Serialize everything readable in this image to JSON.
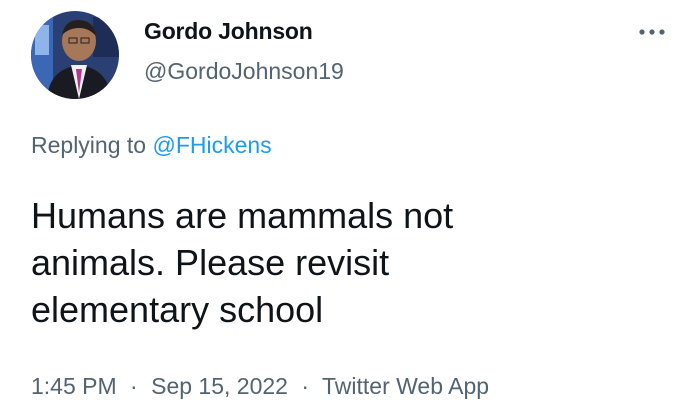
{
  "author": {
    "display_name": "Gordo Johnson",
    "handle": "@GordoJohnson19"
  },
  "more_icon": "more-horizontal-icon",
  "reply": {
    "prefix": "Replying to",
    "to_handle": "@FHickens"
  },
  "tweet": {
    "lines": [
      "Humans are mammals not",
      "animals. Please revisit",
      "elementary school"
    ]
  },
  "meta": {
    "time": "1:45 PM",
    "separator": "·",
    "date": "Sep 15, 2022",
    "source": "Twitter Web App"
  },
  "colors": {
    "link": "#1d9bf0",
    "text": "#0f1419",
    "secondary": "#536471"
  }
}
